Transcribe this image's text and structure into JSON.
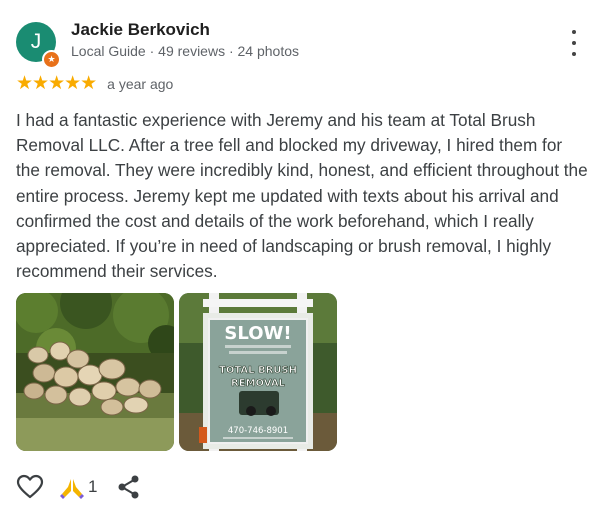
{
  "reviewer": {
    "avatar_letter": "J",
    "name": "Jackie Berkovich",
    "meta": "Local Guide · 49 reviews · 24 photos"
  },
  "review": {
    "rating": 5,
    "stars": "★★★★★",
    "date": "a year ago",
    "text": "I had a fantastic experience with Jeremy and his team at Total Brush Removal LLC. After a tree fell and blocked my driveway, I hired them for the removal. They were incredibly kind, honest, and efficient throughout the entire process. Jeremy kept me updated with texts about his arrival and confirmed the cost and details of the work beforehand, which I really appreciated. If you’re in need of landscaping or brush removal, I highly recommend their services."
  },
  "photos": [
    {
      "name": "cut-logs-photo"
    },
    {
      "name": "yard-sign-photo",
      "sign_slow": "SLOW!",
      "sign_company_line1": "TOTAL BRUSH",
      "sign_company_line2": "REMOVAL",
      "sign_phone": "470-746-8901"
    }
  ],
  "actions": {
    "reaction_count": "1"
  },
  "colors": {
    "avatar_bg": "#1a8c72",
    "local_guide_badge": "#e8711a",
    "star": "#f9ab00"
  }
}
